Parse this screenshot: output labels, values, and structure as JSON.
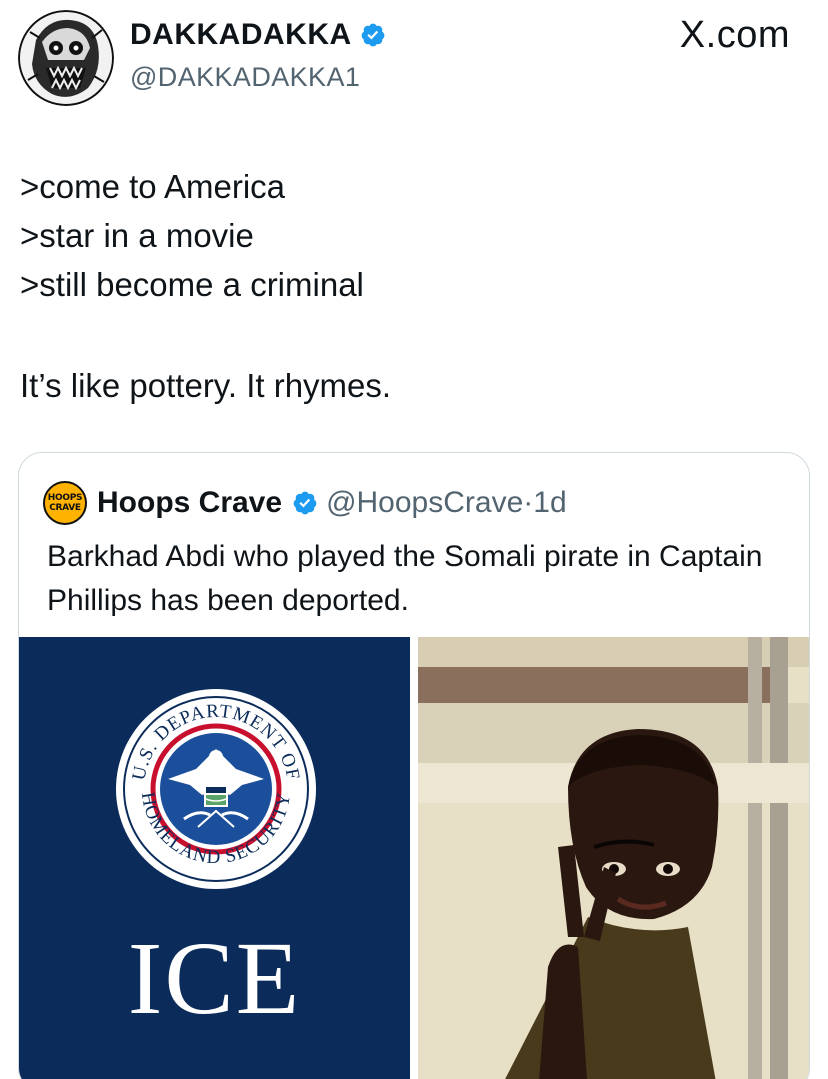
{
  "post": {
    "display_name": "DAKKADAKKA",
    "handle": "@DAKKADAKKA1",
    "brand": "X.com",
    "lines": [
      ">come to America",
      ">star in a movie",
      ">still become a criminal"
    ],
    "closing_line": "It’s like pottery. It rhymes."
  },
  "quote": {
    "avatar_text_top": "HOOPS",
    "avatar_text_bottom": "CRAVE",
    "display_name": "Hoops Crave",
    "handle": "@HoopsCrave",
    "separator": " · ",
    "time": "1d",
    "text": "Barkhad Abdi who played the Somali pirate in Captain Phillips has been deported.",
    "media": {
      "left_caption": "ICE",
      "seal_text": "U.S. DEPARTMENT OF HOMELAND SECURITY"
    }
  },
  "colors": {
    "verified": "#1d9bf0",
    "ice_navy": "#0b2c5a",
    "seal_red": "#c8102e",
    "secondary_text": "#536471"
  }
}
